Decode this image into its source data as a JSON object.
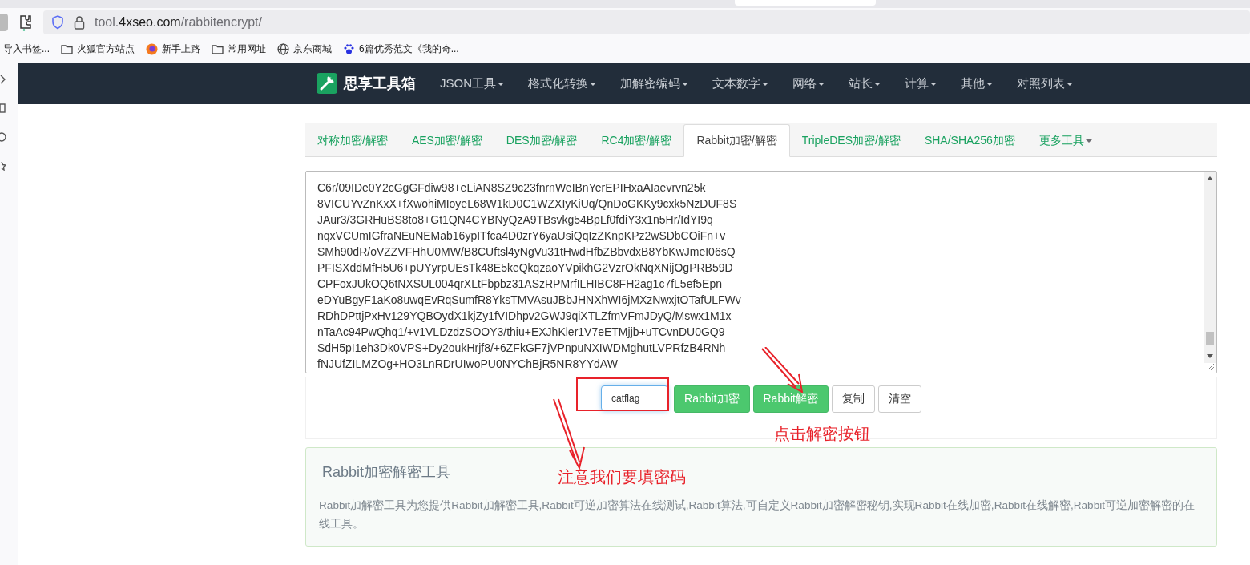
{
  "browser": {
    "url": {
      "prefix": "tool.",
      "domain": "4xseo.com",
      "path": "/rabbitencrypt/"
    },
    "bookmarks": [
      {
        "label": "导入书签...",
        "kind": "plain"
      },
      {
        "label": "火狐官方站点",
        "kind": "folder"
      },
      {
        "label": "新手上路",
        "kind": "firefox"
      },
      {
        "label": "常用网址",
        "kind": "folder"
      },
      {
        "label": "京东商城",
        "kind": "globe"
      },
      {
        "label": "6篇优秀范文《我的奇...",
        "kind": "paw"
      }
    ]
  },
  "navbar": {
    "brand": "思享工具箱",
    "items": [
      "JSON工具",
      "格式化转换",
      "加解密编码",
      "文本数字",
      "网络",
      "站长",
      "计算",
      "其他",
      "对照列表"
    ]
  },
  "tabs": [
    {
      "label": "对称加密/解密",
      "selected": false
    },
    {
      "label": "AES加密/解密",
      "selected": false
    },
    {
      "label": "DES加密/解密",
      "selected": false
    },
    {
      "label": "RC4加密/解密",
      "selected": false
    },
    {
      "label": "Rabbit加密/解密",
      "selected": true
    },
    {
      "label": "TripleDES加密/解密",
      "selected": false
    },
    {
      "label": "SHA/SHA256加密",
      "selected": false
    },
    {
      "label": "更多工具",
      "selected": false
    }
  ],
  "ciphertext": [
    "C6r/09IDe0Y2cGgGFdiw98+eLiAN8SZ9c23fnrnWeIBnYerEPIHxaAIaevrvn25k",
    "8VICUYvZnKxX+fXwohiMIoyeL68W1kD0C1WZXIyKiUq/QnDoGKKy9cxk5NzDUF8S",
    "JAur3/3GRHuBS8to8+Gt1QN4CYBNyQzA9TBsvkg54BpLf0fdiY3x1n5Hr/IdYI9q",
    "nqxVCUmIGfraNEuNEMab16ypITfca4D0zrY6yaUsiQqIzZKnpKPz2wSDbCOiFn+v",
    "SMh90dR/oVZZVFHhU0MW/B8CUftsl4yNgVu31tHwdHfbZBbvdxB8YbKwJmeI06sQ",
    "PFISXddMfH5U6+pUYyrpUEsTk48E5keQkqzaoYVpikhG2VzrOkNqXNijOgPRB59D",
    "CPFoxJUkOQ6tNXSUL004qrXLtFbpbz31ASzRPMrfILHIBC8FH2ag1c7fL5ef5Epn",
    "eDYuBgyF1aKo8uwqEvRqSumfR8YksTMVAsuJBbJHNXhWI6jMXzNwxjtOTafULFWv",
    "RDhDPttjPxHv129YQBOydX1kjZy1fVIDhpv2GWJ9qiXTLZfmVFmJDyQ/Mswx1M1x",
    "nTaAc94PwQhq1/+v1VLDzdzSOOY3/thiu+EXJhKler1V7eETMjjb+uTCvnDU0GQ9",
    "SdH5pI1eh3Dk0VPS+Dy2oukHrjf8/+6ZFkGF7jVPnpuNXIWDMghutLVPRfzB4RNh",
    "fNJUfZILMZOg+HO3LnRDrUIwoPU0NYChBjR5NR8YYdAW"
  ],
  "key_field": {
    "value": "catflag"
  },
  "buttons": [
    {
      "label": "Rabbit加密",
      "kind": "primary"
    },
    {
      "label": "Rabbit解密",
      "kind": "primary"
    },
    {
      "label": "复制",
      "kind": "default"
    },
    {
      "label": "清空",
      "kind": "default"
    }
  ],
  "info": {
    "title": "Rabbit加密解密工具",
    "description": "Rabbit加解密工具为您提供Rabbit加解密工具,Rabbit可逆加密算法在线测试,Rabbit算法,可自定义Rabbit加密解密秘钥,实现Rabbit在线加密,Rabbit在线解密,Rabbit可逆加密解密的在线工具。"
  },
  "annotations": [
    {
      "text": "注意我们要填密码"
    },
    {
      "text": "点击解密按钮"
    }
  ]
}
